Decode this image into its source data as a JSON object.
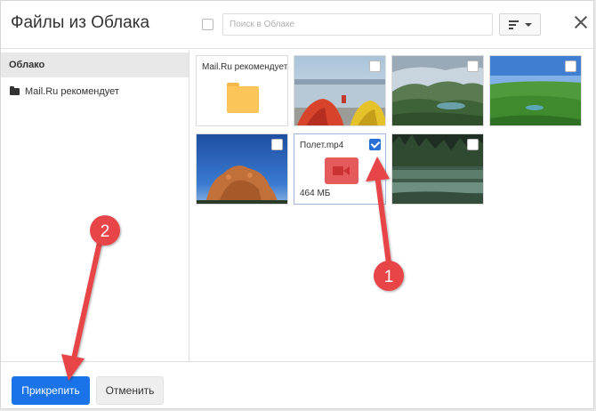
{
  "dialog": {
    "title": "Файлы из Облака",
    "search_placeholder": "Поиск в Облаке"
  },
  "sidebar": {
    "items": [
      {
        "label": "Облако",
        "selected": true
      },
      {
        "label": "Mail.Ru рекомендует",
        "icon": "folder-icon"
      }
    ]
  },
  "files": [
    {
      "type": "folder",
      "label": "Mail.Ru рекомендует",
      "checked": false
    },
    {
      "type": "image",
      "scene": "tents-by-lake",
      "checked": false
    },
    {
      "type": "image",
      "scene": "mountain-valley",
      "checked": false
    },
    {
      "type": "image",
      "scene": "green-field",
      "checked": false
    },
    {
      "type": "image",
      "scene": "rock-sunset",
      "checked": false
    },
    {
      "type": "video",
      "label": "Полет.mp4",
      "size": "464 МБ",
      "checked": true
    },
    {
      "type": "image",
      "scene": "forest-lake",
      "checked": false
    }
  ],
  "footer": {
    "attach_label": "Прикрепить",
    "cancel_label": "Отменить"
  },
  "annotations": [
    {
      "label": "1",
      "target": "video-checkbox"
    },
    {
      "label": "2",
      "target": "attach-button"
    }
  ],
  "colors": {
    "accent": "#1a73e8",
    "checkbox_checked": "#2a6fd6",
    "annotation": "#e8454a",
    "folder": "#fbc55a"
  }
}
